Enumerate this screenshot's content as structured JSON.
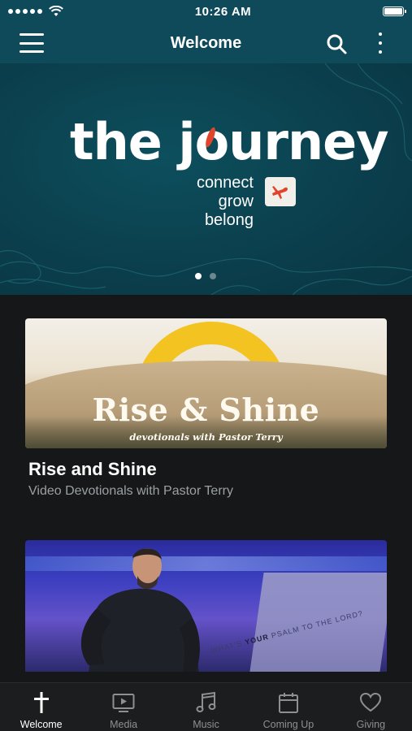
{
  "status_bar": {
    "time": "10:26 AM"
  },
  "nav": {
    "title": "Welcome"
  },
  "hero": {
    "title_pre": "the j",
    "title_o": "o",
    "title_post": "urney",
    "tagline": [
      "connect",
      "grow",
      "belong"
    ],
    "pager_count": 2,
    "pager_active": 0
  },
  "cards": [
    {
      "thumbnail_title": "Rise & Shine",
      "thumbnail_subtitle": "devotionals with Pastor Terry",
      "title": "Rise and Shine",
      "subtitle": "Video Devotionals with Pastor Terry"
    },
    {
      "thumbnail_stage_text_pre": "WHAT'S ",
      "thumbnail_stage_text_bold": "YOUR",
      "thumbnail_stage_text_post": " PSALM TO THE LORD?"
    }
  ],
  "tabs": [
    {
      "label": "Welcome",
      "icon": "cross-icon",
      "active": true
    },
    {
      "label": "Media",
      "icon": "tv-play-icon",
      "active": false
    },
    {
      "label": "Music",
      "icon": "music-note-icon",
      "active": false
    },
    {
      "label": "Coming Up",
      "icon": "calendar-icon",
      "active": false
    },
    {
      "label": "Giving",
      "icon": "heart-icon",
      "active": false
    }
  ],
  "colors": {
    "header": "#0f4a5a",
    "hero": "#0b3e4c",
    "accent": "#e0452c",
    "sun": "#f3c321",
    "background": "#161718"
  }
}
